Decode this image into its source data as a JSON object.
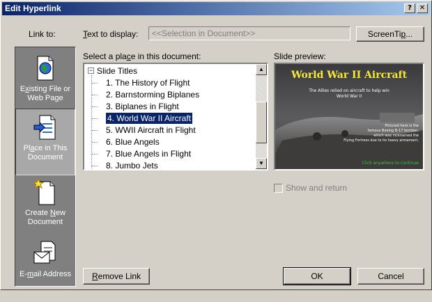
{
  "window": {
    "title": "Edit Hyperlink"
  },
  "title_buttons": {
    "help": "?",
    "close": "✕"
  },
  "link_to": {
    "label": "Link to:",
    "items": [
      {
        "line1_pre": "E",
        "line1_u": "x",
        "line1_post": "isting File or",
        "line2": "Web Page",
        "icon": "globe-document-icon"
      },
      {
        "line1_pre": "Pl",
        "line1_u": "a",
        "line1_post": "ce in This",
        "line2": "Document",
        "icon": "arrow-document-icon",
        "selected": true
      },
      {
        "line1_pre": "Create ",
        "line1_u": "N",
        "line1_post": "ew",
        "line2": "Document",
        "icon": "new-document-icon"
      },
      {
        "line1_pre": "E-",
        "line1_u": "m",
        "line1_post": "ail Address",
        "line2": "",
        "icon": "envelope-icon"
      }
    ]
  },
  "text_to_display": {
    "label_u": "T",
    "label_rest": "ext to display:",
    "value": "<<Selection in Document>>"
  },
  "screentip_button": {
    "pre": "ScreenTi",
    "u": "p",
    "post": "..."
  },
  "place_label": {
    "pre": "Select a pla",
    "u": "c",
    "post": "e in this document:"
  },
  "tree": {
    "root": "Slide Titles",
    "items": [
      "1. The History of Flight",
      "2. Barnstorming Biplanes",
      "3. Biplanes in Flight",
      "4. World War II Aircraft",
      "5. WWII Aircraft in Flight",
      "6. Blue Angels",
      "7. Blue Angels in Flight",
      "8. Jumbo Jets"
    ],
    "selected_index": 3
  },
  "preview": {
    "label": "Slide preview:",
    "slide_title": "World War II Aircraft",
    "caption_line1": "The Allies relied on aircraft to help win",
    "caption_line2": "World War II",
    "note_line1": "Pictured here is the",
    "note_line2": "famous Boeing B-17 bomber,",
    "note_line3": "which was nicknamed the",
    "note_line4": "Flying Fortress due to its heavy armament.",
    "footer": "Click anywhere to continue"
  },
  "show_and_return": {
    "label": "Show and return",
    "checked": false,
    "enabled": false
  },
  "remove_link": {
    "pre": "",
    "u": "R",
    "post": "emove Link"
  },
  "ok_button": "OK",
  "cancel_button": "Cancel",
  "colors": {
    "title_active": "#0a246a",
    "selection": "#0a246a",
    "slide_title": "#f5e93a",
    "slide_footer": "#39c23a"
  }
}
